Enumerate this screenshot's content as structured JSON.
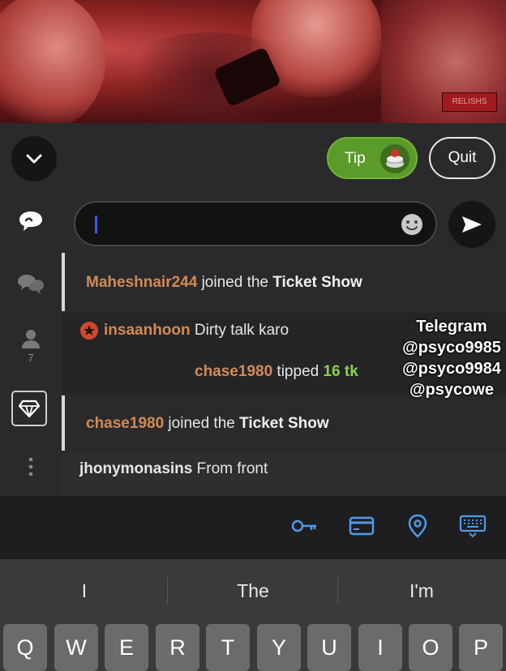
{
  "video": {
    "badge": "RELISHS"
  },
  "header": {
    "tip_label": "Tip",
    "quit_label": "Quit"
  },
  "sidebar": {
    "users_count": "7"
  },
  "chat": {
    "messages": [
      {
        "user": "Maheshnair244",
        "text": " joined the ",
        "bold": "Ticket Show"
      },
      {
        "user": "insaanhoon",
        "text": " Dirty talk karo"
      },
      {
        "user": "chase1980",
        "text": " tipped ",
        "amount": "16 tk"
      },
      {
        "user": "chase1980",
        "text": " joined the ",
        "bold": "Ticket Show"
      },
      {
        "user": "jhonymonasins",
        "text": " From front"
      }
    ]
  },
  "watermark": {
    "lines": [
      "Telegram",
      "@psyco9985",
      "@psyco9984",
      "@psycowe"
    ]
  },
  "keyboard": {
    "suggestions": [
      "I",
      "The",
      "I'm"
    ],
    "keys": [
      "Q",
      "W",
      "E",
      "R",
      "T",
      "Y",
      "U",
      "I",
      "O",
      "P"
    ]
  },
  "colors": {
    "tip_green": "#5a9b2a",
    "username_orange": "#d48a55",
    "amount_green": "#8cd14a",
    "caret_blue": "#2f5fff"
  }
}
